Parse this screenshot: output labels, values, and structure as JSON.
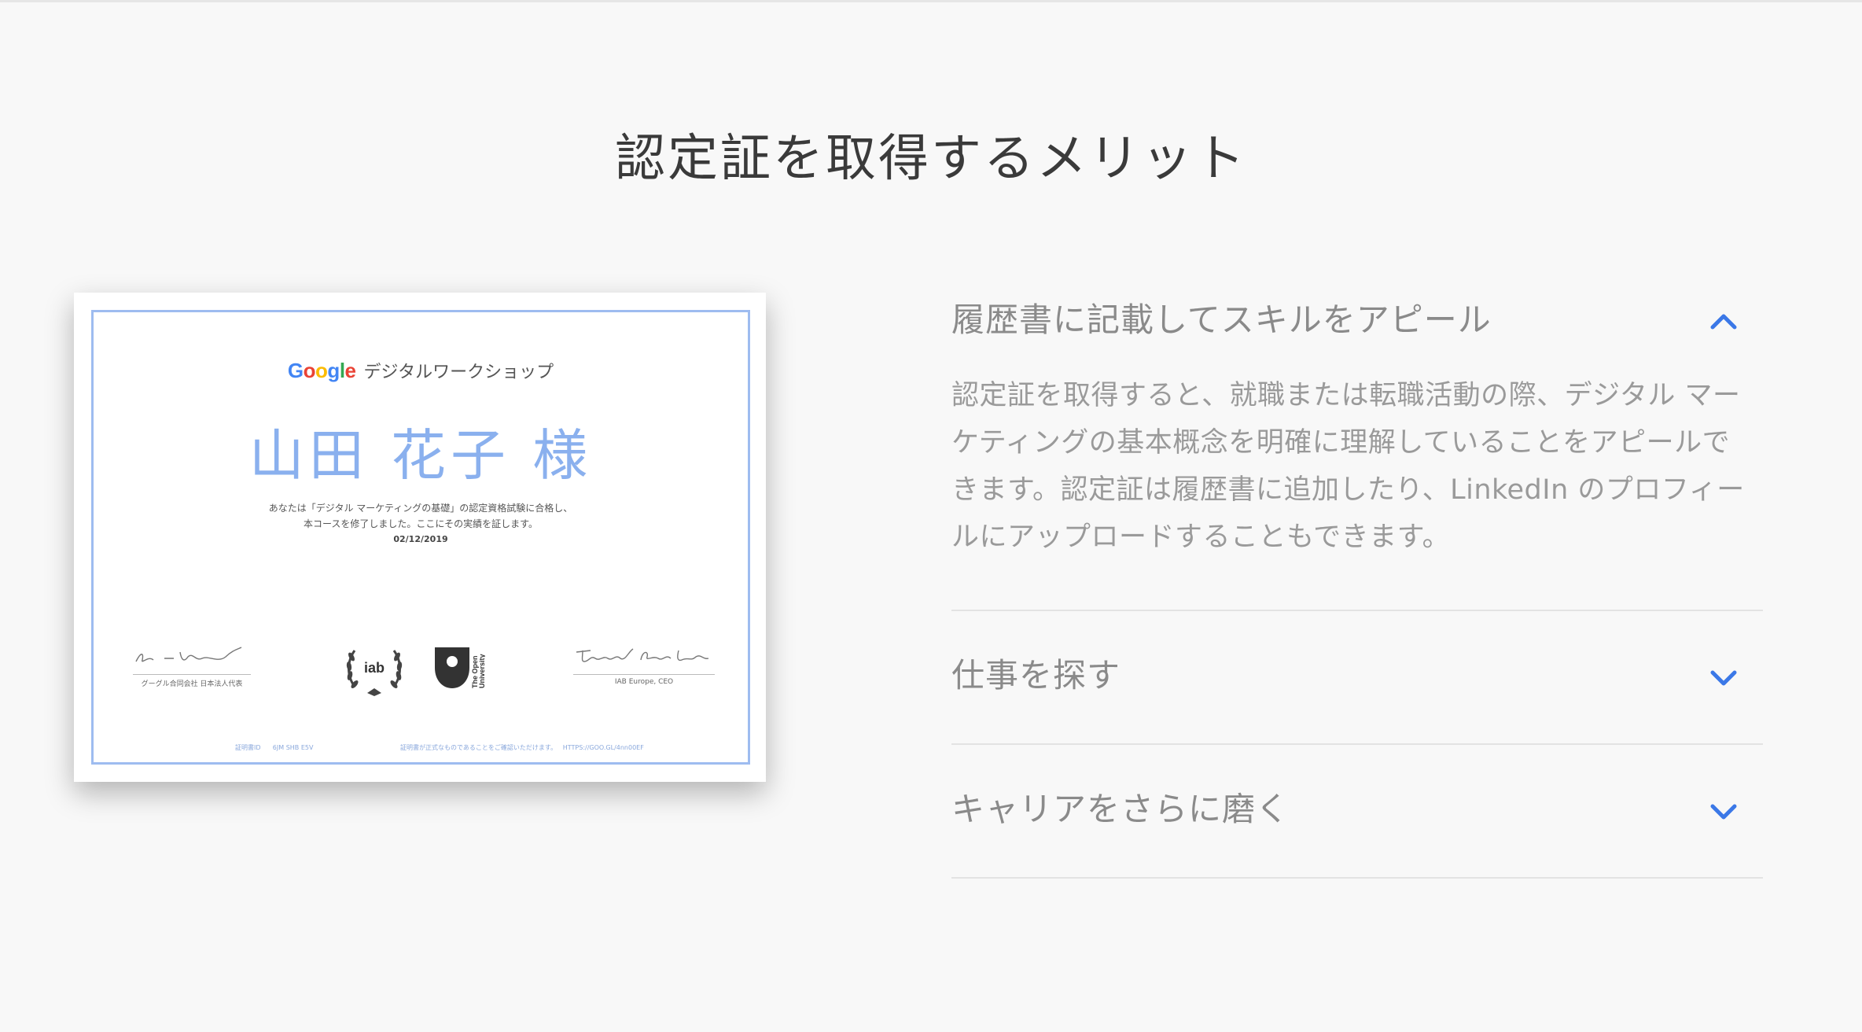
{
  "section": {
    "title": "認定証を取得するメリット"
  },
  "certificate": {
    "logo_letters": [
      "G",
      "o",
      "o",
      "g",
      "l",
      "e"
    ],
    "workshop": "デジタルワークショップ",
    "recipient": "山田 花子 様",
    "line1": "あなたは「デジタル マーケティングの基礎」の認定資格試験に合格し、",
    "line2": "本コースを修了しました。ここにその実績を証します。",
    "date": "02/12/2019",
    "sig_left_caption": "グーグル合同会社 日本法人代表",
    "sig_right_caption": "IAB Europe, CEO",
    "iab_text": "iab",
    "ou_text_1": "The Open",
    "ou_text_2": "University",
    "footer_id_label": "証明書ID",
    "footer_id": "6JM SHB E5V",
    "footer_verify": "証明書が正式なものであることをご確認いただけます。",
    "footer_url": "HTTPS://GOO.GL/4nn00EF",
    "colors": {
      "blue": "#4285f4",
      "red": "#ea4335",
      "yellow": "#fbbc05",
      "green": "#34a853",
      "name": "#8ab0ee",
      "frame": "#9ebcf0"
    }
  },
  "accordion": {
    "accent": "#3b78e7",
    "items": [
      {
        "title": "履歴書に記載してスキルをアピール",
        "expanded": true,
        "icon": "chevron-up-icon",
        "body_lines": [
          "認定証を取得すると、就職または転職活動の際、デジタル マー",
          "ケティングの基本概念を明確に理解していることをアピールで",
          "きます。認定証は履歴書に追加したり、LinkedIn のプロフィー",
          "ルにアップロードすることもできます。"
        ]
      },
      {
        "title": "仕事を探す",
        "expanded": false,
        "icon": "chevron-down-icon"
      },
      {
        "title": "キャリアをさらに磨く",
        "expanded": false,
        "icon": "chevron-down-icon"
      }
    ]
  }
}
